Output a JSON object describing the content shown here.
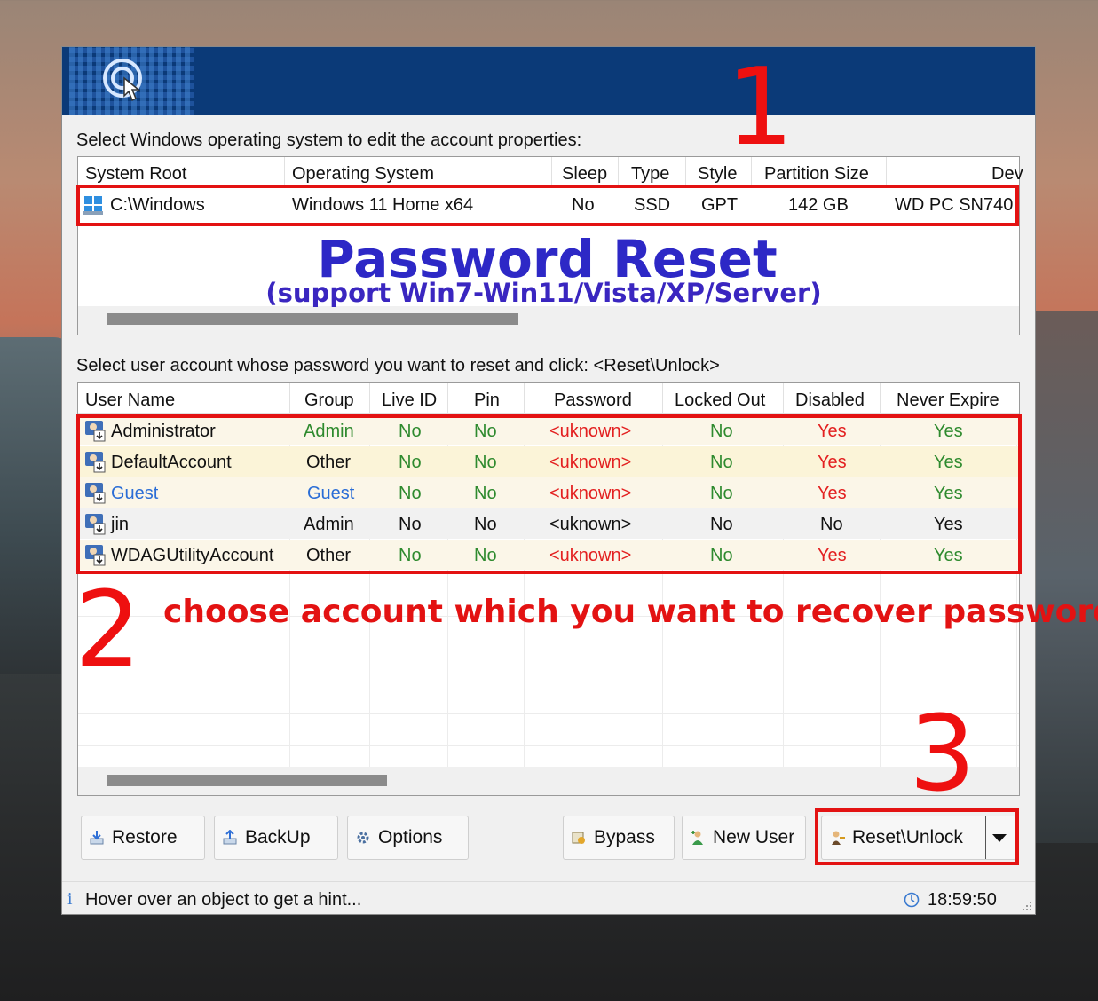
{
  "labels": {
    "select_os": "Select Windows operating system to edit the account properties:",
    "select_user": "Select user account whose password you want to reset and click: <Reset\\Unlock>"
  },
  "os_table": {
    "columns": [
      "System Root",
      "Operating System",
      "Sleep",
      "Type",
      "Style",
      "Partition Size",
      "Dev"
    ],
    "rows": [
      {
        "system_root": "C:\\Windows",
        "operating_system": "Windows 11 Home x64",
        "sleep": "No",
        "type": "SSD",
        "style": "GPT",
        "partition_size": "142 GB",
        "device": "WD PC SN740"
      }
    ]
  },
  "overlay": {
    "title": "Password Reset",
    "subtitle": "(support Win7-Win11/Vista/XP/Server)",
    "step1": "1",
    "step2": "2",
    "step3": "3",
    "step2_text": "choose account which you want to recover password"
  },
  "user_table": {
    "columns": [
      "User Name",
      "Group",
      "Live ID",
      "Pin",
      "Password",
      "Locked Out",
      "Disabled",
      "Never Expire"
    ],
    "rows": [
      {
        "name": "Administrator",
        "group": "Admin",
        "live_id": "No",
        "pin": "No",
        "password": "<uknown>",
        "locked_out": "No",
        "disabled": "Yes",
        "never_expire": "Yes"
      },
      {
        "name": "DefaultAccount",
        "group": "Other",
        "live_id": "No",
        "pin": "No",
        "password": "<uknown>",
        "locked_out": "No",
        "disabled": "Yes",
        "never_expire": "Yes"
      },
      {
        "name": "Guest",
        "group": "Guest",
        "live_id": "No",
        "pin": "No",
        "password": "<uknown>",
        "locked_out": "No",
        "disabled": "Yes",
        "never_expire": "Yes"
      },
      {
        "name": "jin",
        "group": "Admin",
        "live_id": "No",
        "pin": "No",
        "password": "<uknown>",
        "locked_out": "No",
        "disabled": "No",
        "never_expire": "Yes"
      },
      {
        "name": "WDAGUtilityAccount",
        "group": "Other",
        "live_id": "No",
        "pin": "No",
        "password": "<uknown>",
        "locked_out": "No",
        "disabled": "Yes",
        "never_expire": "Yes"
      }
    ]
  },
  "buttons": {
    "restore": "Restore",
    "backup": "BackUp",
    "options": "Options",
    "bypass": "Bypass",
    "new_user": "New User",
    "reset_unlock": "Reset\\Unlock"
  },
  "status": {
    "hint": "Hover over an object to get a hint...",
    "info_glyph": "i",
    "time": "18:59:50"
  },
  "colors": {
    "banner": "#0b3a78",
    "annotation_red": "#e31212",
    "overlay_blue": "#2d28c6",
    "green_value": "#2e8a2e",
    "red_value": "#e32020",
    "guest_blue": "#2a6dd6"
  },
  "icons": [
    "app-logo-icon",
    "windows-drive-icon",
    "user-account-icon",
    "restore-icon",
    "backup-icon",
    "gear-icon",
    "bypass-icon",
    "new-user-icon",
    "reset-key-icon",
    "dropdown-arrow-icon",
    "clock-icon",
    "info-icon",
    "resize-grip-icon"
  ]
}
